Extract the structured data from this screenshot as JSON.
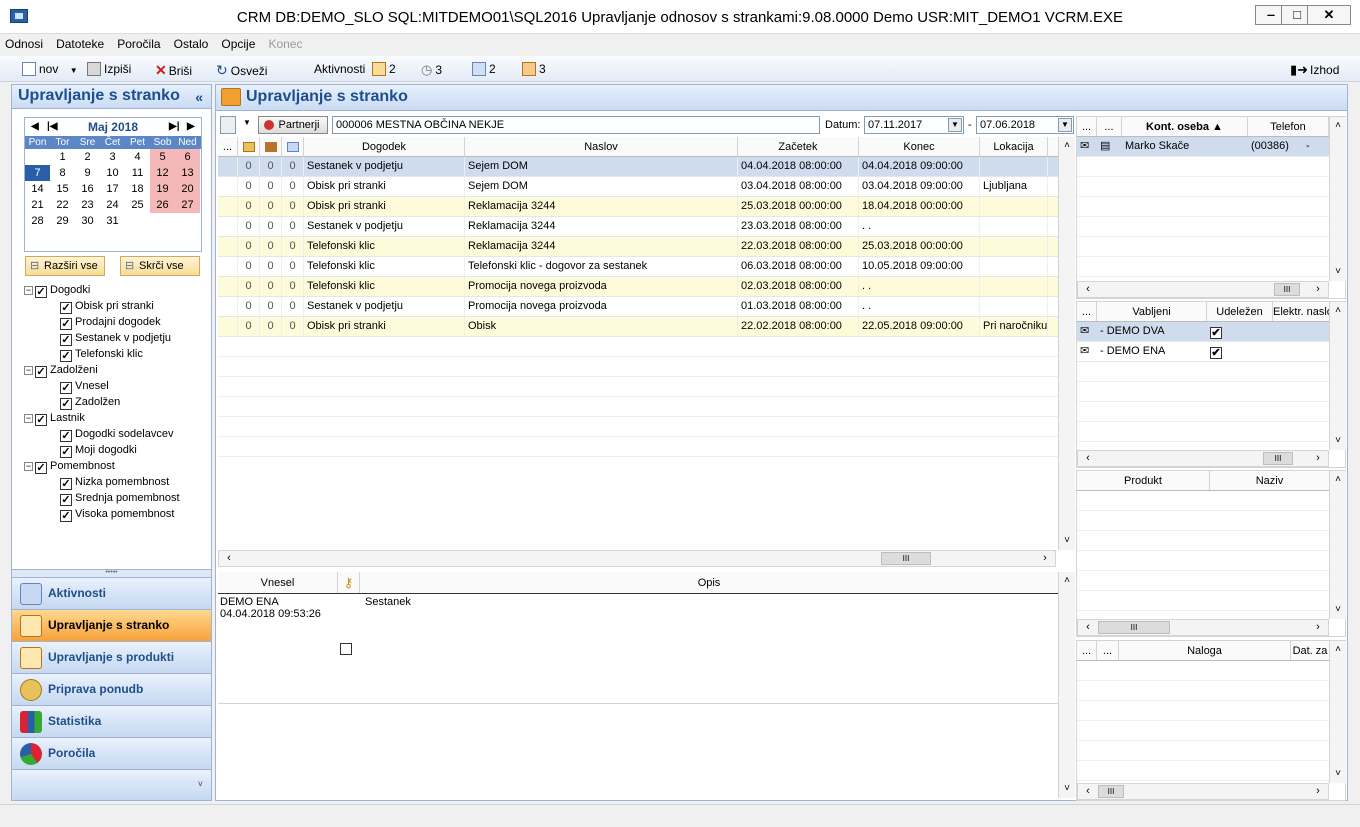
{
  "window": {
    "title": "CRM   DB:DEMO_SLO   SQL:MITDEMO01\\SQL2016   Upravljanje odnosov s strankami:9.08.0000   Demo   USR:MIT_DEMO1   VCRM.EXE",
    "minimize": "‒",
    "maximize": "□",
    "close": "✕"
  },
  "menu": [
    "Odnosi",
    "Datoteke",
    "Poročila",
    "Ostalo",
    "Opcije",
    "Konec"
  ],
  "toolbar": {
    "new": "nov",
    "print": "Izpiši",
    "delete": "Briši",
    "refresh": "Osveži",
    "activities": "Aktivnosti",
    "count1": "2",
    "count2": "3",
    "count3": "2",
    "count4": "3",
    "exit": "Izhod"
  },
  "left": {
    "title": "Upravljanje s stranko",
    "collapse": "«",
    "calendar": {
      "month": "Maj 2018",
      "days": [
        "Pon",
        "Tor",
        "Sre",
        "Čet",
        "Pet",
        "Sob",
        "Ned"
      ],
      "weeks": [
        [
          "",
          "1",
          "2",
          "3",
          "4",
          "5",
          "6"
        ],
        [
          "7",
          "8",
          "9",
          "10",
          "11",
          "12",
          "13"
        ],
        [
          "14",
          "15",
          "16",
          "17",
          "18",
          "19",
          "20"
        ],
        [
          "21",
          "22",
          "23",
          "24",
          "25",
          "26",
          "27"
        ],
        [
          "28",
          "29",
          "30",
          "31",
          "",
          "",
          ""
        ]
      ]
    },
    "expand_all": "Razširi vse",
    "collapse_all": "Skrči vse",
    "tree": [
      {
        "label": "Dogodki",
        "children": [
          "Obisk pri stranki",
          "Prodajni dogodek",
          "Sestanek v podjetju",
          "Telefonski klic"
        ]
      },
      {
        "label": "Zadolženi",
        "children": [
          "Vnesel",
          "Zadolžen"
        ]
      },
      {
        "label": "Lastnik",
        "children": [
          "Dogodki sodelavcev",
          "Moji dogodki"
        ]
      },
      {
        "label": "Pomembnost",
        "children": [
          "Nizka pomembnost",
          "Srednja pomembnost",
          "Visoka pomembnost"
        ]
      }
    ],
    "nav": [
      "Aktivnosti",
      "Upravljanje s stranko",
      "Upravljanje s produkti",
      "Priprava ponudb",
      "Statistika",
      "Poročila"
    ],
    "grip": "•••••",
    "nav_footer": "˅"
  },
  "main": {
    "title": "Upravljanje s stranko",
    "partner_button": "Partnerji",
    "partner_value": "000006 MESTNA OBČINA NEKJE",
    "date_label": "Datum:",
    "date_from": "07.11.2017",
    "date_sep": "-",
    "date_to": "07.06.2018",
    "columns": [
      "...",
      "",
      "",
      "",
      "Dogodek",
      "Naslov",
      "Začetek",
      "Konec",
      "Lokacija"
    ],
    "rows": [
      [
        "0",
        "0",
        "0",
        "Sestanek v podjetju",
        "Sejem DOM",
        "04.04.2018 08:00:00",
        "04.04.2018 09:00:00",
        ""
      ],
      [
        "0",
        "0",
        "0",
        "Obisk pri stranki",
        "Sejem DOM",
        "03.04.2018 08:00:00",
        "03.04.2018 09:00:00",
        "Ljubljana"
      ],
      [
        "0",
        "0",
        "0",
        "Obisk pri stranki",
        "Reklamacija 3244",
        "25.03.2018 00:00:00",
        "18.04.2018 00:00:00",
        ""
      ],
      [
        "0",
        "0",
        "0",
        "Sestanek v podjetju",
        "Reklamacija 3244",
        "23.03.2018 08:00:00",
        ". .",
        ""
      ],
      [
        "0",
        "0",
        "0",
        "Telefonski klic",
        "Reklamacija 3244",
        "22.03.2018 08:00:00",
        "25.03.2018 00:00:00",
        ""
      ],
      [
        "0",
        "0",
        "0",
        "Telefonski klic",
        "Telefonski klic - dogovor za sestanek",
        "06.03.2018 08:00:00",
        "10.05.2018 09:00:00",
        ""
      ],
      [
        "0",
        "0",
        "0",
        "Telefonski klic",
        "Promocija novega proizvoda",
        "02.03.2018 08:00:00",
        ". .",
        ""
      ],
      [
        "0",
        "0",
        "0",
        "Sestanek v podjetju",
        "Promocija novega proizvoda",
        "01.03.2018 08:00:00",
        ". .",
        ""
      ],
      [
        "0",
        "0",
        "0",
        "Obisk pri stranki",
        "Obisk",
        "22.02.2018 08:00:00",
        "22.05.2018 09:00:00",
        "Pri naročniku"
      ]
    ],
    "notes": {
      "col_entered": "Vnesel",
      "col_desc": "Opis",
      "entered_by": "DEMO ENA",
      "entered_at": "04.04.2018 09:53:26",
      "description": "Sestanek"
    }
  },
  "right": {
    "contacts": {
      "columns": [
        "...",
        "...",
        "Kont. oseba ▲",
        "Telefon"
      ],
      "rows": [
        [
          "Marko Skače",
          "(00386)",
          "-"
        ]
      ]
    },
    "invited": {
      "columns": [
        "...",
        "Vabljeni",
        "Udeležen",
        "Elektr. naslo"
      ],
      "rows": [
        [
          "- DEMO DVA",
          "✔"
        ],
        [
          "- DEMO ENA",
          "✔"
        ]
      ]
    },
    "products": {
      "columns": [
        "Produkt",
        "Naziv"
      ]
    },
    "tasks": {
      "columns": [
        "...",
        "...",
        "Naloga",
        "Dat. za"
      ]
    },
    "scroll_thumb": "III"
  },
  "colors": {
    "accent": "#1e4e8c",
    "selected_row": "#cfdcee",
    "alt_row": "#fdfbd9",
    "weekend": "#f4b8b8",
    "active_nav": "#f7a23b"
  }
}
